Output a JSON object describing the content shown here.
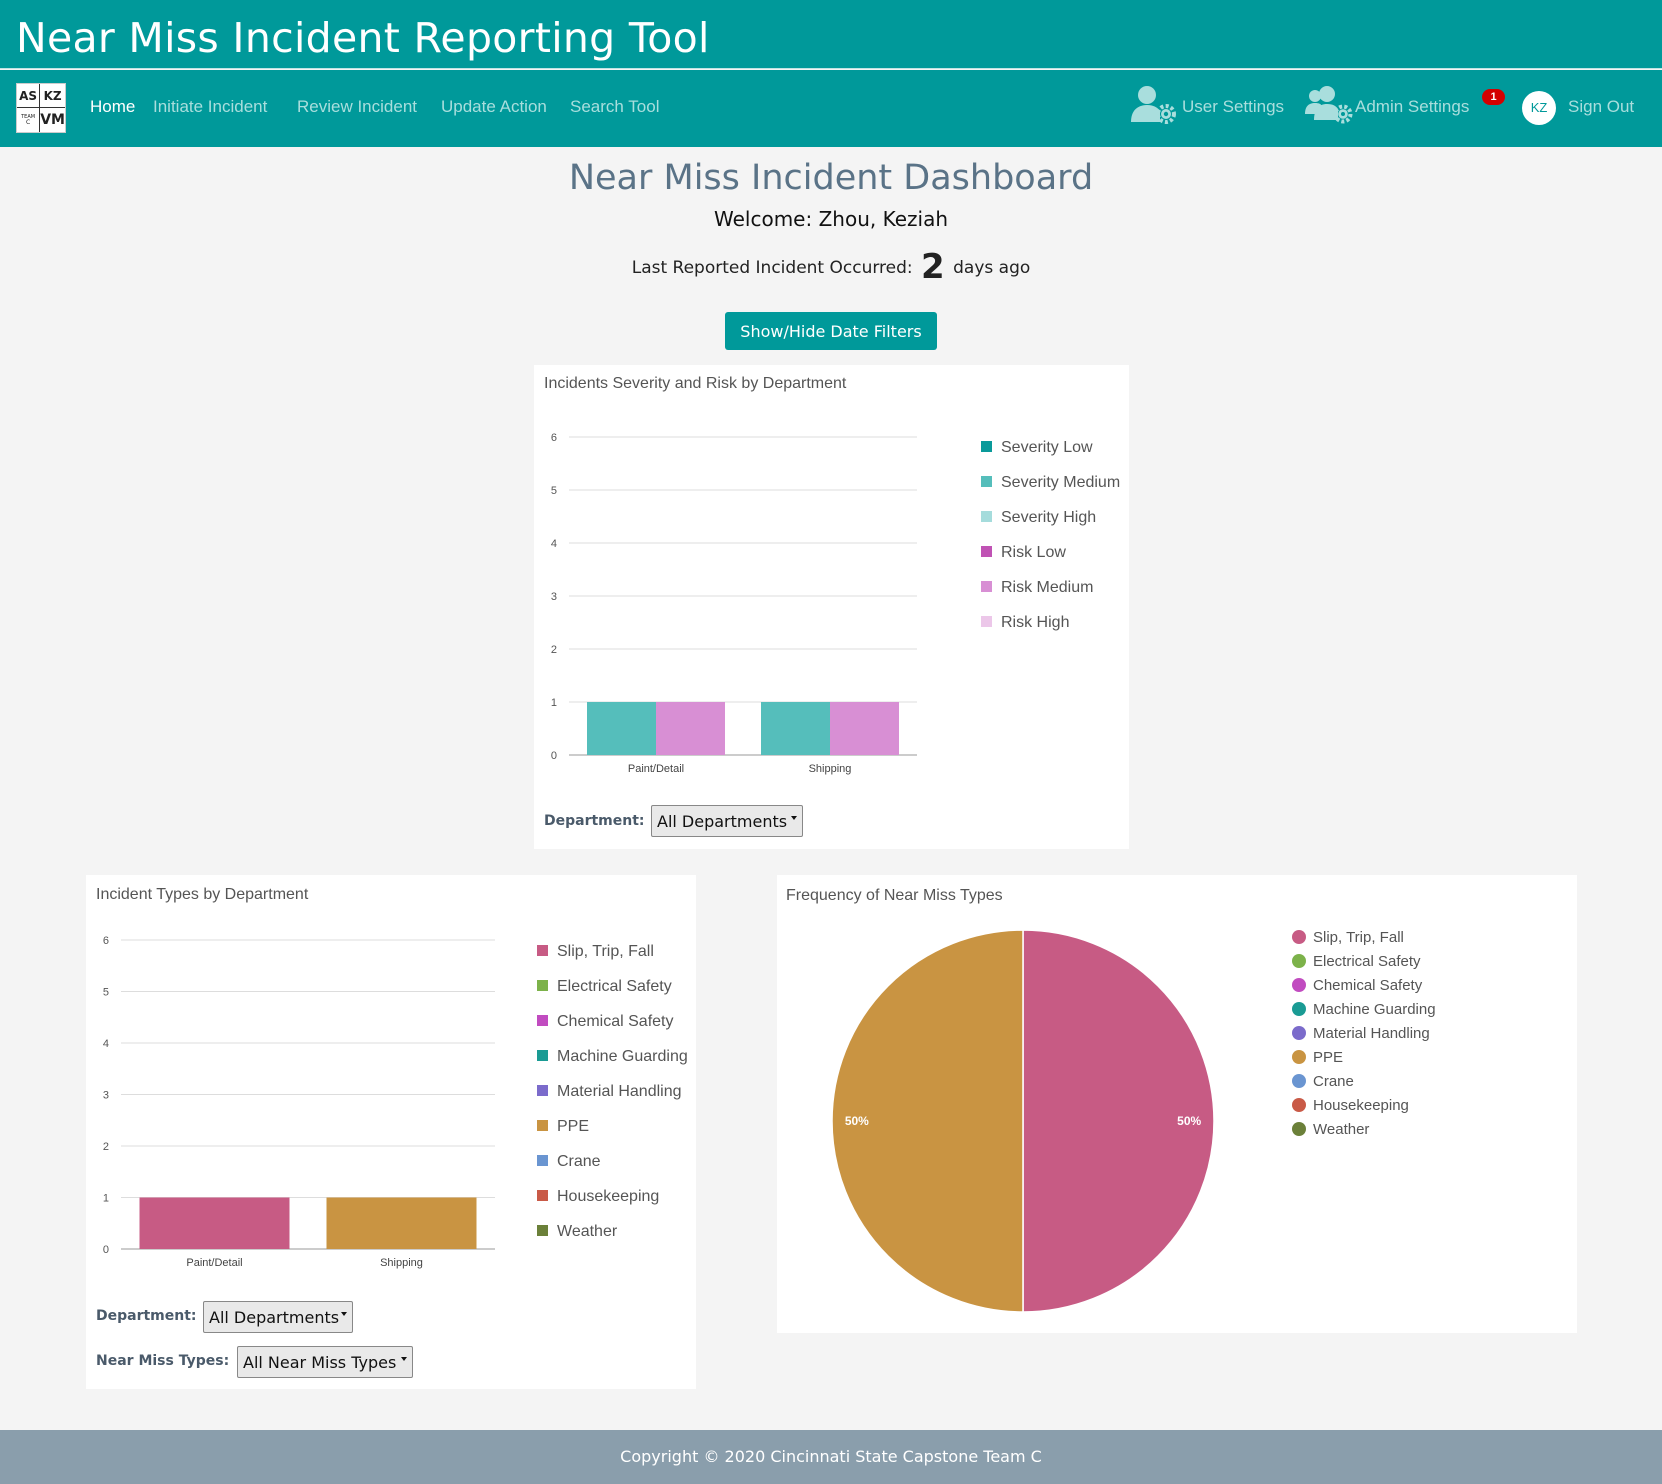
{
  "header": {
    "title": "Near Miss Incident Reporting Tool"
  },
  "logo": {
    "cells": [
      "AS",
      "KZ",
      "TEAM",
      "C",
      "VM"
    ]
  },
  "nav": {
    "links": [
      "Home",
      "Initiate Incident",
      "Review Incident",
      "Update Action",
      "Search Tool"
    ],
    "user_settings": "User Settings",
    "admin_settings": "Admin Settings",
    "admin_badge": "1",
    "avatar_initials": "KZ",
    "sign_out": "Sign Out"
  },
  "dashboard": {
    "title": "Near Miss Incident Dashboard",
    "welcome": "Welcome: Zhou, Keziah",
    "last_incident_prefix": "Last Reported Incident Occurred:",
    "last_incident_days": "2",
    "last_incident_suffix": "days ago",
    "filters_button": "Show/Hide Date Filters"
  },
  "filters": {
    "department_label": "Department:",
    "department_value": "All Departments",
    "near_miss_label": "Near Miss Types:",
    "near_miss_value": "All Near Miss Types"
  },
  "footer": {
    "text": "Copyright © 2020 Cincinnati State Capstone Team C"
  },
  "chart_data": [
    {
      "type": "bar",
      "title": "Incidents Severity and Risk by Department",
      "categories": [
        "Paint/Detail",
        "Shipping"
      ],
      "ylim": [
        0,
        6
      ],
      "yticks": [
        "0",
        "1",
        "2",
        "3",
        "4",
        "5",
        "6"
      ],
      "grid": true,
      "legend_position": "right",
      "series": [
        {
          "name": "Severity Low",
          "color": "#0a9a9a",
          "values": [
            0,
            0
          ]
        },
        {
          "name": "Severity Medium",
          "color": "#55bebb",
          "values": [
            1,
            1
          ]
        },
        {
          "name": "Severity High",
          "color": "#a5dcdc",
          "values": [
            0,
            0
          ]
        },
        {
          "name": "Risk Low",
          "color": "#c052b4",
          "values": [
            0,
            0
          ]
        },
        {
          "name": "Risk Medium",
          "color": "#d88fd4",
          "values": [
            1,
            1
          ]
        },
        {
          "name": "Risk High",
          "color": "#ecc7e9",
          "values": [
            0,
            0
          ]
        }
      ]
    },
    {
      "type": "bar",
      "title": "Incident Types by Department",
      "categories": [
        "Paint/Detail",
        "Shipping"
      ],
      "ylim": [
        0,
        6
      ],
      "yticks": [
        "0",
        "1",
        "2",
        "3",
        "4",
        "5",
        "6"
      ],
      "grid": true,
      "legend_position": "right",
      "series": [
        {
          "name": "Slip, Trip, Fall",
          "color": "#c75b84",
          "values": [
            1,
            0
          ]
        },
        {
          "name": "Electrical Safety",
          "color": "#7cb24a",
          "values": [
            0,
            0
          ]
        },
        {
          "name": "Chemical Safety",
          "color": "#c14cc0",
          "values": [
            0,
            0
          ]
        },
        {
          "name": "Machine Guarding",
          "color": "#1a9b94",
          "values": [
            0,
            0
          ]
        },
        {
          "name": "Material Handling",
          "color": "#7b6bcb",
          "values": [
            0,
            0
          ]
        },
        {
          "name": "PPE",
          "color": "#c99442",
          "values": [
            0,
            1
          ]
        },
        {
          "name": "Crane",
          "color": "#6a95d1",
          "values": [
            0,
            0
          ]
        },
        {
          "name": "Housekeeping",
          "color": "#c95a47",
          "values": [
            0,
            0
          ]
        },
        {
          "name": "Weather",
          "color": "#6b8039",
          "values": [
            0,
            0
          ]
        }
      ]
    },
    {
      "type": "pie",
      "title": "Frequency of Near Miss Types",
      "legend_position": "right",
      "slices": [
        {
          "name": "Slip, Trip, Fall",
          "color": "#c75b84",
          "value": 50,
          "label": "50%"
        },
        {
          "name": "Electrical Safety",
          "color": "#7cb24a",
          "value": 0
        },
        {
          "name": "Chemical Safety",
          "color": "#c14cc0",
          "value": 0
        },
        {
          "name": "Machine Guarding",
          "color": "#1a9b94",
          "value": 0
        },
        {
          "name": "Material Handling",
          "color": "#7b6bcb",
          "value": 0
        },
        {
          "name": "PPE",
          "color": "#c99442",
          "value": 50,
          "label": "50%"
        },
        {
          "name": "Crane",
          "color": "#6a95d1",
          "value": 0
        },
        {
          "name": "Housekeeping",
          "color": "#c95a47",
          "value": 0
        },
        {
          "name": "Weather",
          "color": "#6b8039",
          "value": 0
        }
      ]
    }
  ]
}
